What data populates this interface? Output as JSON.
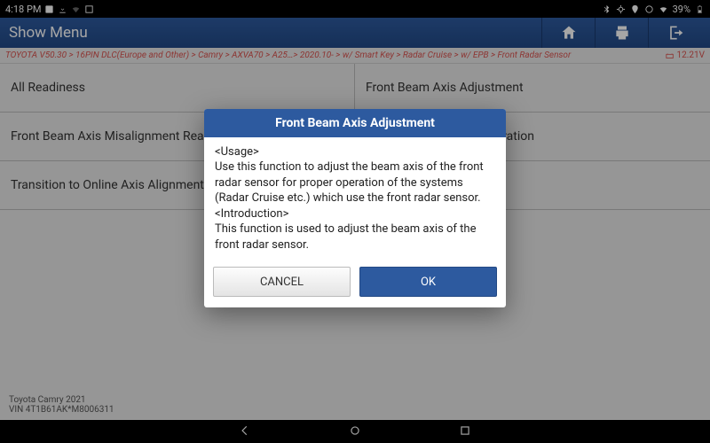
{
  "status": {
    "time": "4:18 PM",
    "battery": "39%"
  },
  "header": {
    "title": "Show Menu"
  },
  "breadcrumb": {
    "path": "TOYOTA V50.30 > 16PIN DLC(Europe and Other) > Camry > AXVA70 > A25…> 2020.10- > w/ Smart Key > Radar Cruise > w/ EPB > Front Radar Sensor",
    "voltage": "12.21V"
  },
  "menu": [
    "All Readiness",
    "Front Beam Axis Adjustment",
    "Front Beam Axis Misalignment Reading",
    "Front Radar Sensor Calibration",
    "Transition to Online Axis Alignment Mode",
    ""
  ],
  "footer": {
    "line1": "Toyota Camry 2021",
    "line2": "VIN 4T1B61AK*M8006311"
  },
  "dialog": {
    "title": "Front Beam Axis Adjustment",
    "body": "<Usage>\nUse this function to adjust the beam axis of the front radar sensor for proper operation of the systems (Radar Cruise etc.) which use the front radar sensor.\n<Introduction>\nThis function is used to adjust the beam axis of the front radar sensor.",
    "cancel": "CANCEL",
    "ok": "OK"
  }
}
